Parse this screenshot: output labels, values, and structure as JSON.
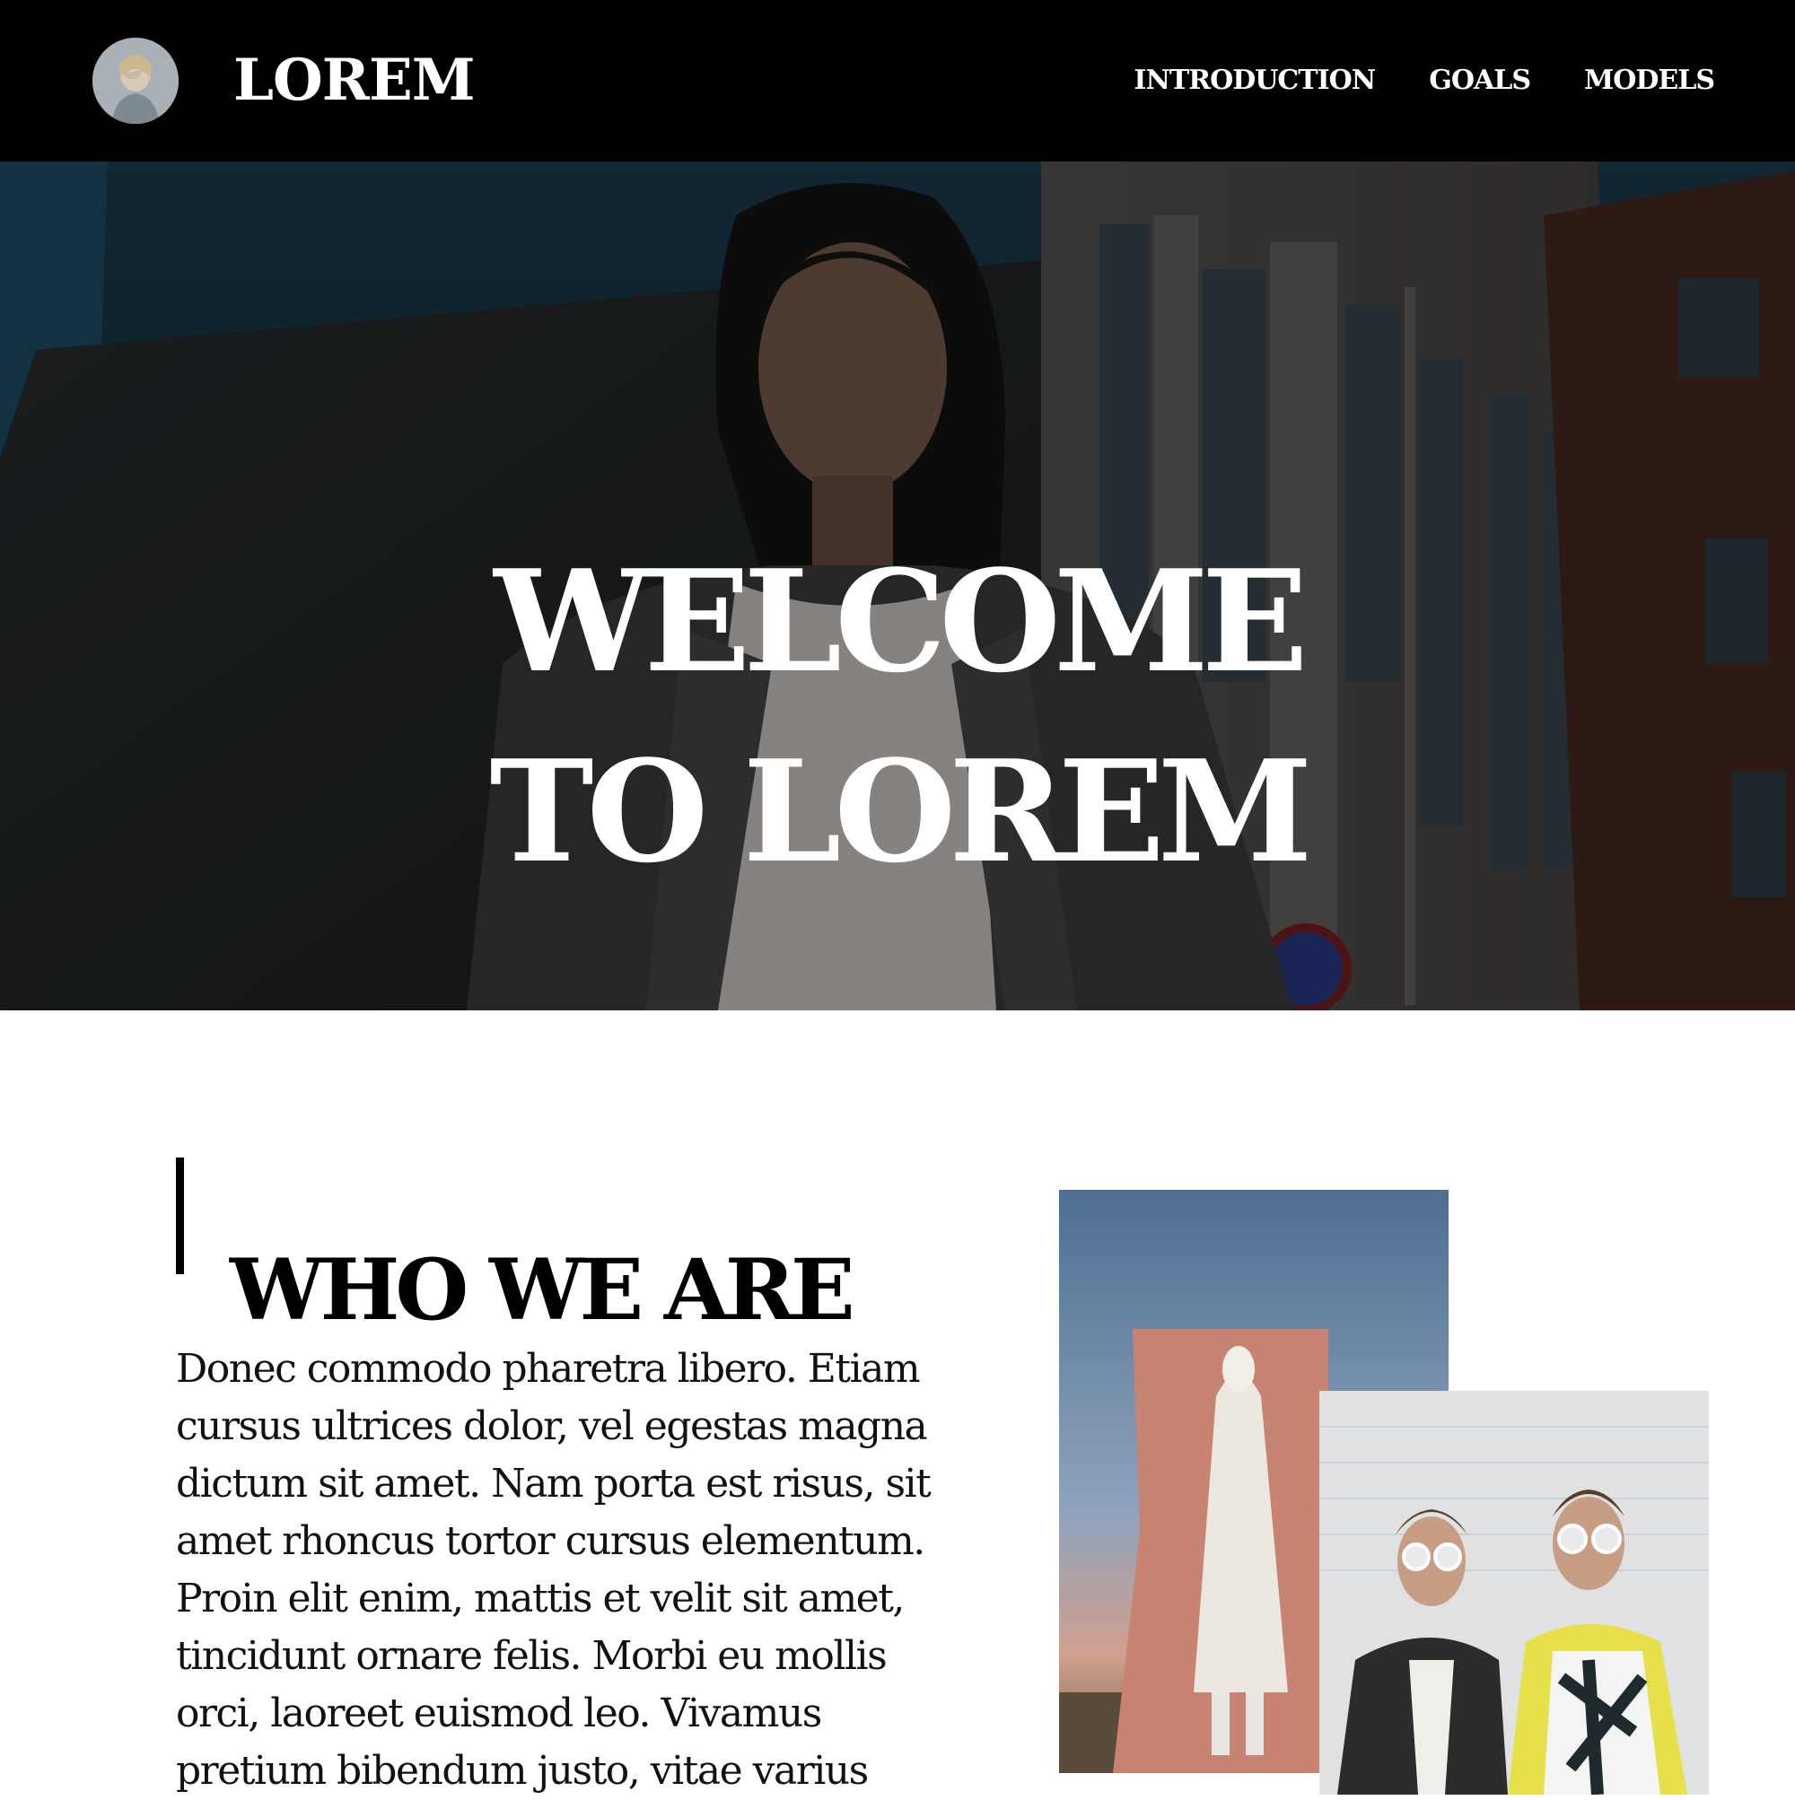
{
  "header": {
    "brand_name": "LOREM",
    "nav": [
      {
        "label": "INTRODUCTION"
      },
      {
        "label": "GOALS"
      },
      {
        "label": "MODELS"
      }
    ]
  },
  "hero": {
    "title_line1": "WELCOME",
    "title_line2": "TO LOREM"
  },
  "about": {
    "heading": "WHO WE ARE",
    "body": "Donec commodo pharetra libero. Etiam cursus ultrices dolor, vel egestas magna dictum sit amet. Nam porta est risus, sit amet rhoncus tortor cursus elementum. Proin elit enim, mattis et velit sit amet, tincidunt ornare felis. Morbi eu mollis orci, laoreet euismod leo. Vivamus pretium bibendum justo, vitae varius"
  },
  "colors": {
    "header_bg": "#000000",
    "header_text": "#ffffff",
    "page_bg": "#ffffff",
    "accent": "#000000"
  }
}
